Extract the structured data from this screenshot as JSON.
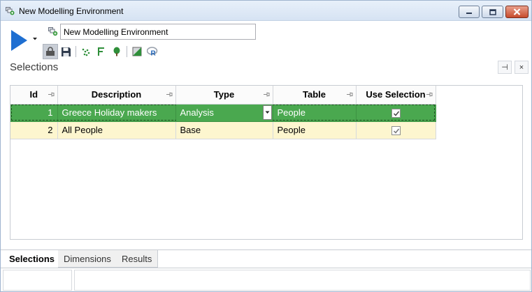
{
  "window": {
    "title": "New Modelling Environment"
  },
  "toolbar": {
    "name_value": "New Modelling Environment",
    "tools": [
      "lock-icon",
      "save-icon",
      "scatter-icon",
      "function-icon",
      "tree-icon",
      "gradient-icon",
      "r-icon"
    ]
  },
  "panel": {
    "title": "Selections",
    "pin_glyph": "⊣",
    "close_glyph": "×"
  },
  "grid": {
    "columns": [
      "Id",
      "Description",
      "Type",
      "Table",
      "Use Selection"
    ],
    "rows": [
      {
        "id": "1",
        "description": "Greece Holiday makers",
        "type": "Analysis",
        "table": "People",
        "use_selection": true
      },
      {
        "id": "2",
        "description": "All People",
        "type": "Base",
        "table": "People",
        "use_selection": true
      }
    ]
  },
  "tabs": [
    {
      "label": "Selections",
      "active": true
    },
    {
      "label": "Dimensions",
      "active": false
    },
    {
      "label": "Results",
      "active": false
    }
  ],
  "colors": {
    "selected_row": "#4aa84f",
    "alt_row": "#fdf6cf",
    "run_icon": "#1f6fd1"
  }
}
